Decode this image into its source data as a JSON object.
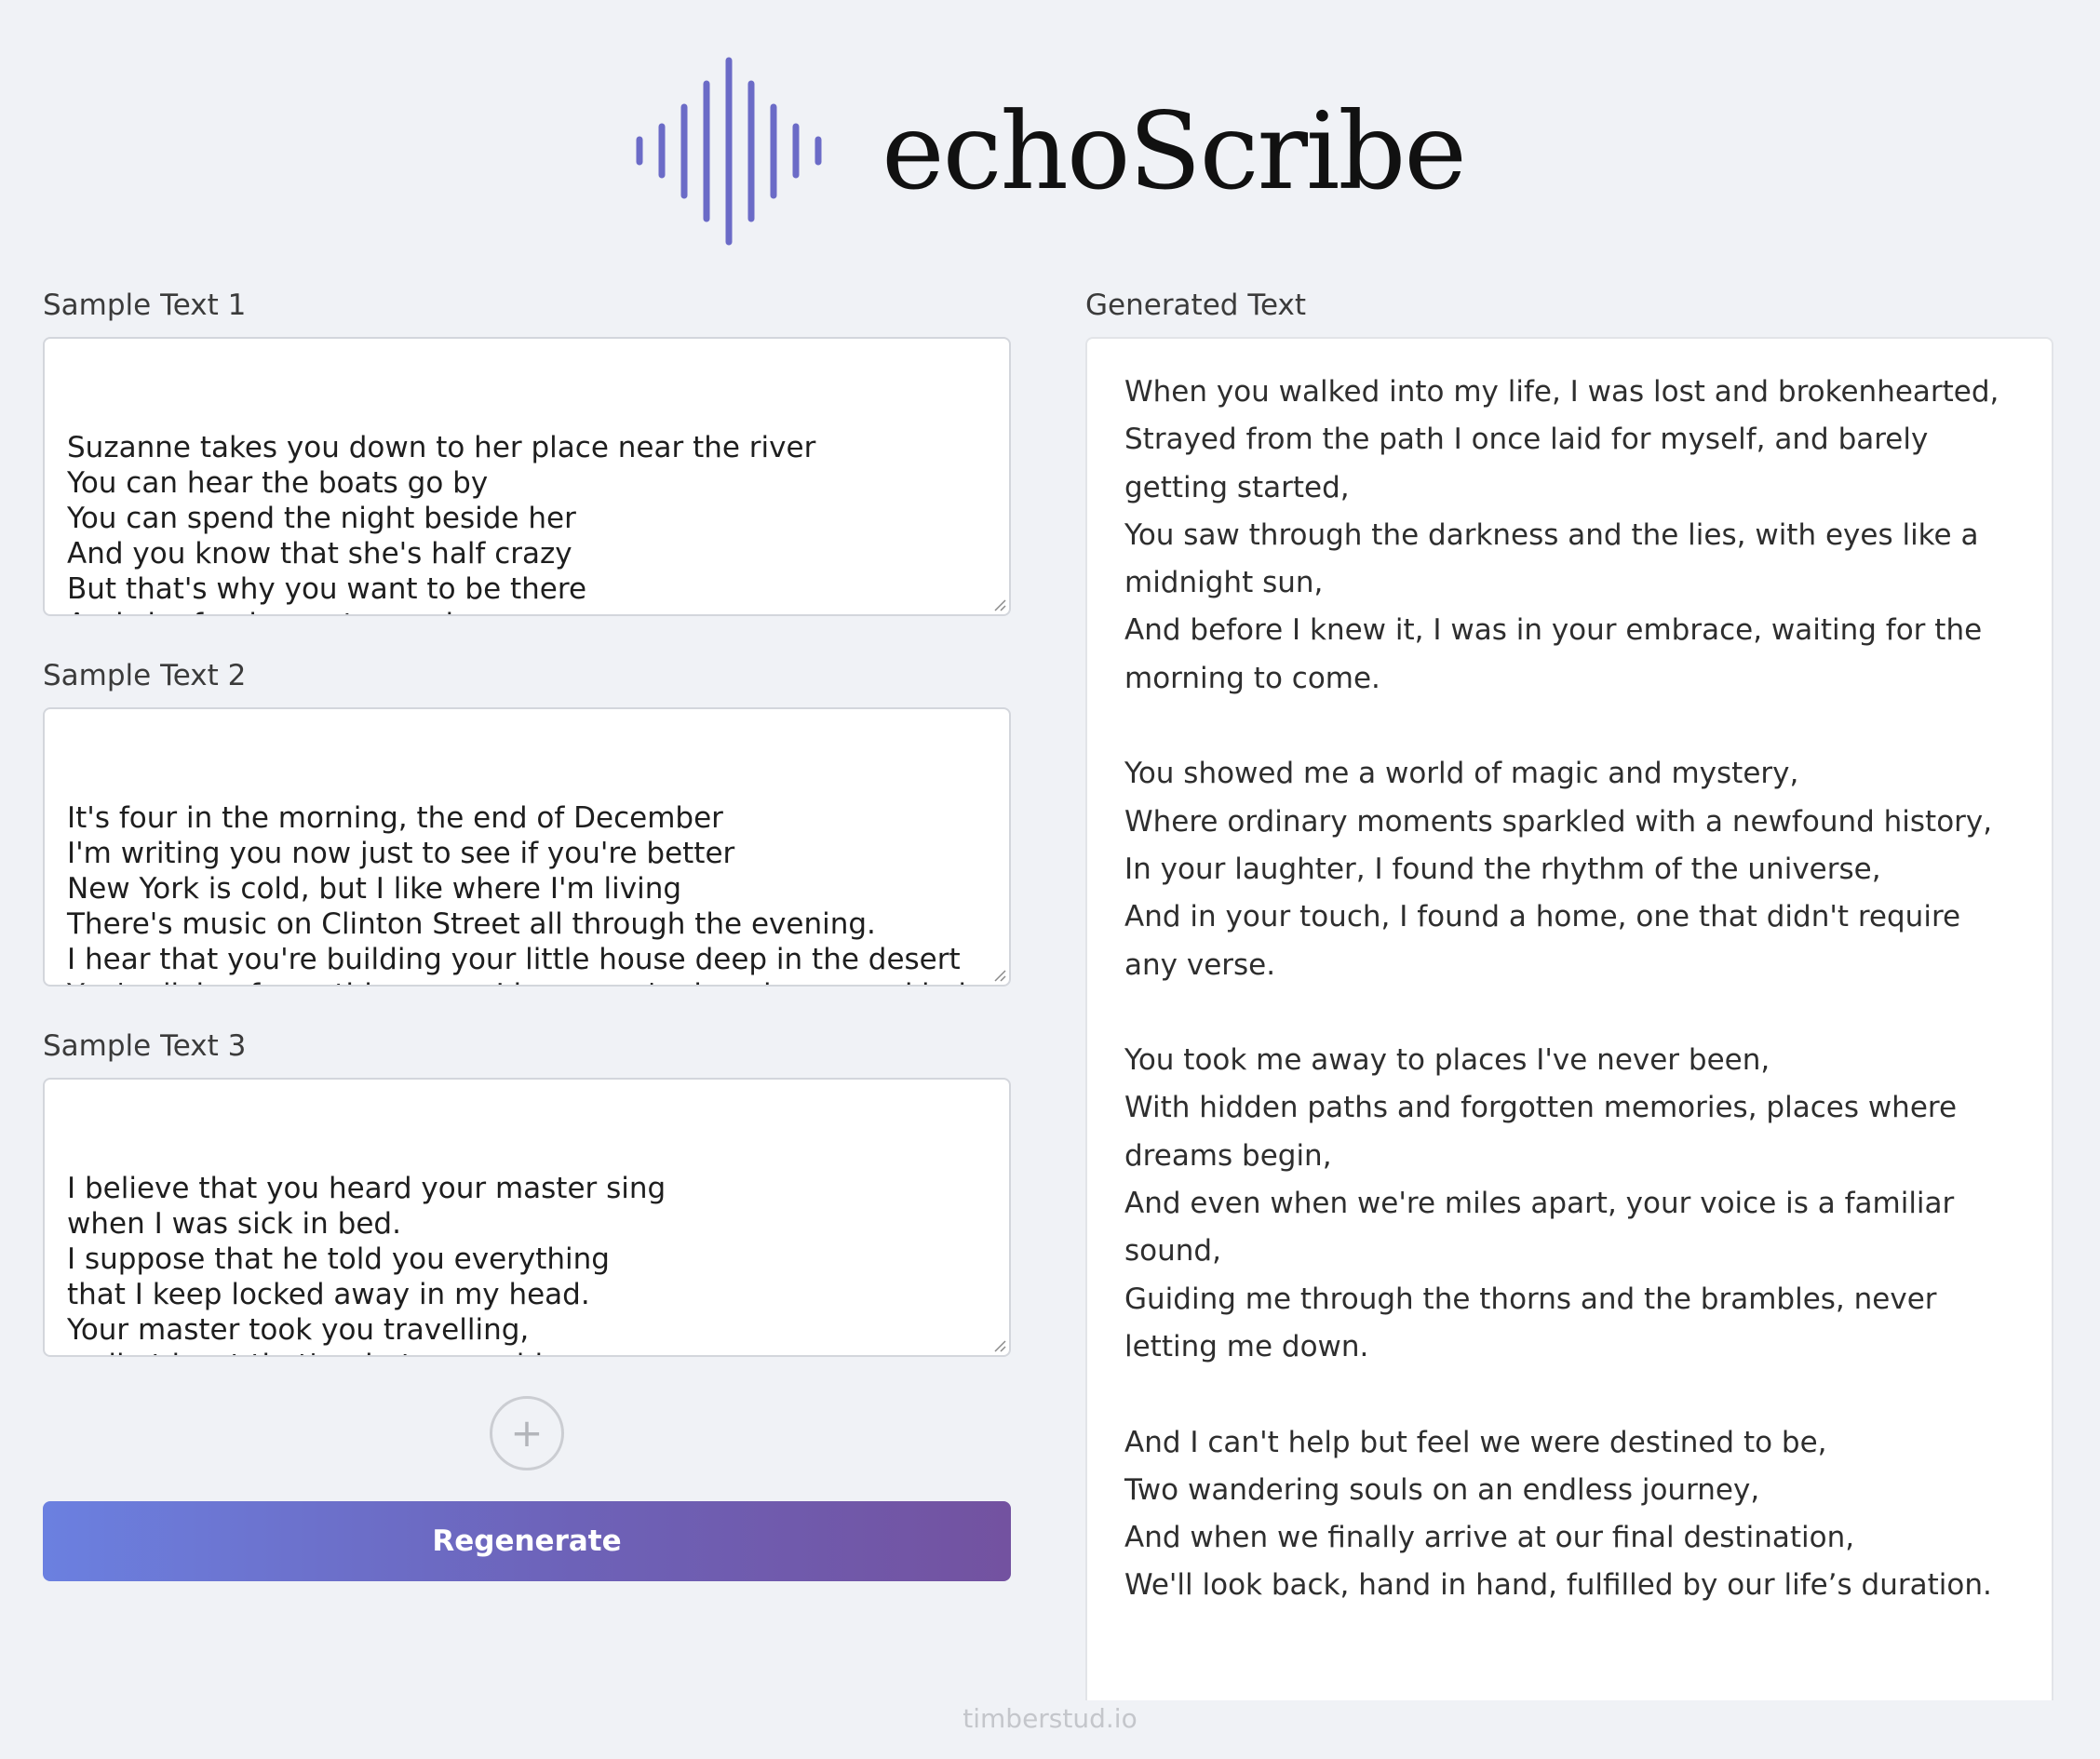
{
  "brand": {
    "name": "echoScribe",
    "accent_color": "#6b6bc7",
    "logo_icon": "sound-wave-icon"
  },
  "samples": [
    {
      "label": "Sample Text 1",
      "text": "Suzanne takes you down to her place near the river\nYou can hear the boats go by\nYou can spend the night beside her\nAnd you know that she's half crazy\nBut that's why you want to be there\nAnd she feeds you tea and oranges\nThat come all the way from China"
    },
    {
      "label": "Sample Text 2",
      "text": "It's four in the morning, the end of December\nI'm writing you now just to see if you're better\nNew York is cold, but I like where I'm living\nThere's music on Clinton Street all through the evening.\nI hear that you're building your little house deep in the desert\nYou're living for nothing now, I hope you're keeping some kind of record."
    },
    {
      "label": "Sample Text 3",
      "text": "I believe that you heard your master sing\nwhen I was sick in bed.\nI suppose that he told you everything\nthat I keep locked away in my head.\nYour master took you travelling,\nwell at least that's what you said.\nAnd now do you come back to bring"
    }
  ],
  "add_button": {
    "symbol": "+",
    "icon": "plus-icon"
  },
  "regenerate": {
    "label": "Regenerate"
  },
  "generated": {
    "label": "Generated Text",
    "lines": [
      "When you walked into my life, I was lost and brokenhearted,",
      "Strayed from the path I once laid for myself, and barely",
      "getting started,",
      "You saw through the darkness and the lies, with eyes like a",
      "midnight sun,",
      "And before I knew it, I was in your embrace, waiting for the",
      "morning to come.",
      "",
      "You showed me a world of magic and mystery,",
      "Where ordinary moments sparkled with a newfound history,",
      "In your laughter, I found the rhythm of the universe,",
      "And in your touch, I found a home, one that didn't require",
      "any verse.",
      "",
      "You took me away to places I've never been,",
      "With hidden paths and forgotten memories, places where",
      "dreams begin,",
      "And even when we're miles apart, your voice is a familiar",
      "sound,",
      "Guiding me through the thorns and the brambles, never",
      "letting me down.",
      "",
      "And I can't help but feel we were destined to be,",
      "Two wandering souls on an endless journey,",
      "And when we finally arrive at our final destination,",
      "We'll look back, hand in hand, fulfilled by our life’s duration."
    ]
  },
  "footer": {
    "text": "timberstud.io"
  }
}
